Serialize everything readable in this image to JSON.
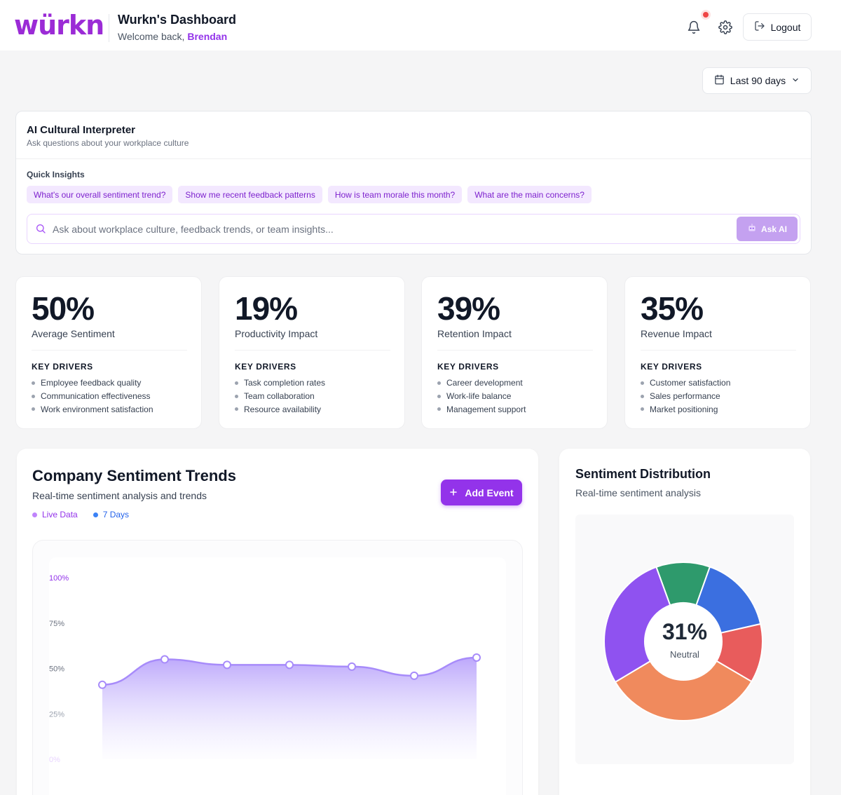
{
  "header": {
    "logo": "würkn",
    "title": "Wurkn's Dashboard",
    "welcome_prefix": "Welcome back, ",
    "user_name": "Brendan",
    "logout_label": "Logout",
    "icons": [
      "bell-icon",
      "gear-icon",
      "logout-icon"
    ]
  },
  "date_range": {
    "label": "Last 90 days",
    "icon": "calendar-icon"
  },
  "ai_interpreter": {
    "title": "AI Cultural Interpreter",
    "subtitle": "Ask questions about your workplace culture",
    "quick_insights_label": "Quick Insights",
    "chips": [
      "What's our overall sentiment trend?",
      "Show me recent feedback patterns",
      "How is team morale this month?",
      "What are the main concerns?"
    ],
    "input_placeholder": "Ask about workplace culture, feedback trends, or team insights...",
    "ask_label": "Ask AI"
  },
  "metrics": [
    {
      "value": "50%",
      "label": "Average Sentiment",
      "drivers_title": "KEY DRIVERS",
      "drivers": [
        "Employee feedback quality",
        "Communication effectiveness",
        "Work environment satisfaction"
      ]
    },
    {
      "value": "19%",
      "label": "Productivity Impact",
      "drivers_title": "KEY DRIVERS",
      "drivers": [
        "Task completion rates",
        "Team collaboration",
        "Resource availability"
      ]
    },
    {
      "value": "39%",
      "label": "Retention Impact",
      "drivers_title": "KEY DRIVERS",
      "drivers": [
        "Career development",
        "Work-life balance",
        "Management support"
      ]
    },
    {
      "value": "35%",
      "label": "Revenue Impact",
      "drivers_title": "KEY DRIVERS",
      "drivers": [
        "Customer satisfaction",
        "Sales performance",
        "Market positioning"
      ]
    }
  ],
  "trends": {
    "title": "Company Sentiment Trends",
    "subtitle": "Real-time sentiment analysis and trends",
    "legend": [
      {
        "label": "Live Data",
        "color": "#a855f7"
      },
      {
        "label": "7 Days",
        "color": "#3b82f6"
      }
    ],
    "add_event_label": "Add Event"
  },
  "distribution": {
    "title": "Sentiment Distribution",
    "subtitle": "Real-time sentiment analysis",
    "center_value": "31%",
    "center_label": "Neutral"
  },
  "chart_data": [
    {
      "type": "area",
      "title": "Company Sentiment Trends",
      "y_tick_labels": [
        "100%",
        "75%",
        "50%",
        "25%",
        "0%"
      ],
      "ylim": [
        0,
        100
      ],
      "x": [
        1,
        2,
        3,
        4,
        5,
        6,
        7
      ],
      "series": [
        {
          "name": "Live Data",
          "values": [
            41,
            55,
            52,
            52,
            51,
            46,
            56
          ]
        }
      ],
      "grid": false
    },
    {
      "type": "pie",
      "title": "Sentiment Distribution",
      "center_value": "31%",
      "center_label": "Neutral",
      "slices": [
        {
          "value": 11,
          "color": "#2e9a6c"
        },
        {
          "value": 16,
          "color": "#3b6fe0"
        },
        {
          "value": 12,
          "color": "#e85c5c"
        },
        {
          "value": 33,
          "color": "#f08a5d"
        },
        {
          "value": 28,
          "color": "#8f52f0"
        }
      ]
    }
  ]
}
